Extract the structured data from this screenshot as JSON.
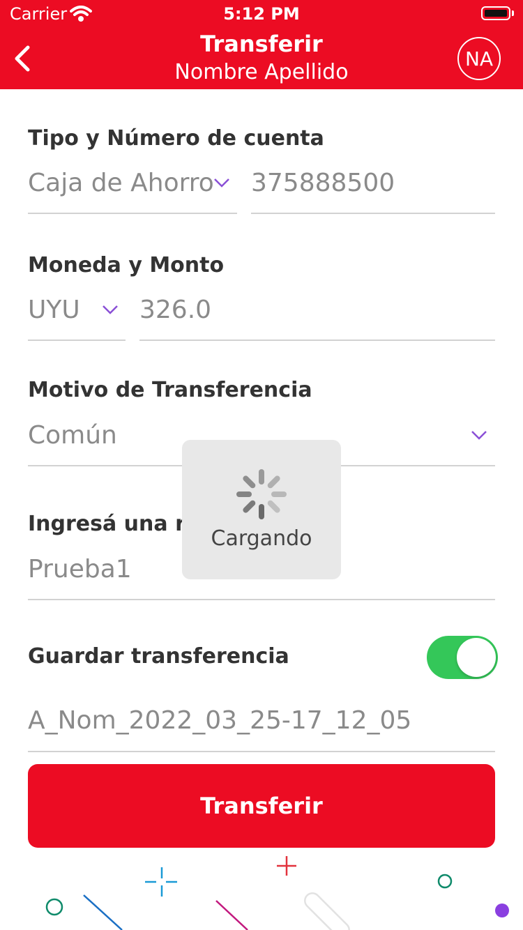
{
  "status_bar": {
    "carrier": "Carrier",
    "time": "5:12 PM"
  },
  "header": {
    "title": "Transferir",
    "subtitle": "Nombre Apellido",
    "avatar_initials": "NA"
  },
  "account": {
    "label": "Tipo y Número de cuenta",
    "type_value": "Caja de Ahorro",
    "number_value": "375888500"
  },
  "amount": {
    "label": "Moneda y Monto",
    "currency_value": "UYU",
    "amount_value": "326.0"
  },
  "reason": {
    "label": "Motivo de Transferencia",
    "value": "Común"
  },
  "reference": {
    "label": "Ingresá una re",
    "value": "Prueba1"
  },
  "save": {
    "label": "Guardar transferencia",
    "enabled": true,
    "name_value": "A_Nom_2022_03_25-17_12_05"
  },
  "loading": {
    "text": "Cargando"
  },
  "submit": {
    "label": "Transferir"
  },
  "colors": {
    "brand": "#ec0c23",
    "toggle_on": "#34c759",
    "chevron": "#8a4fd6"
  }
}
